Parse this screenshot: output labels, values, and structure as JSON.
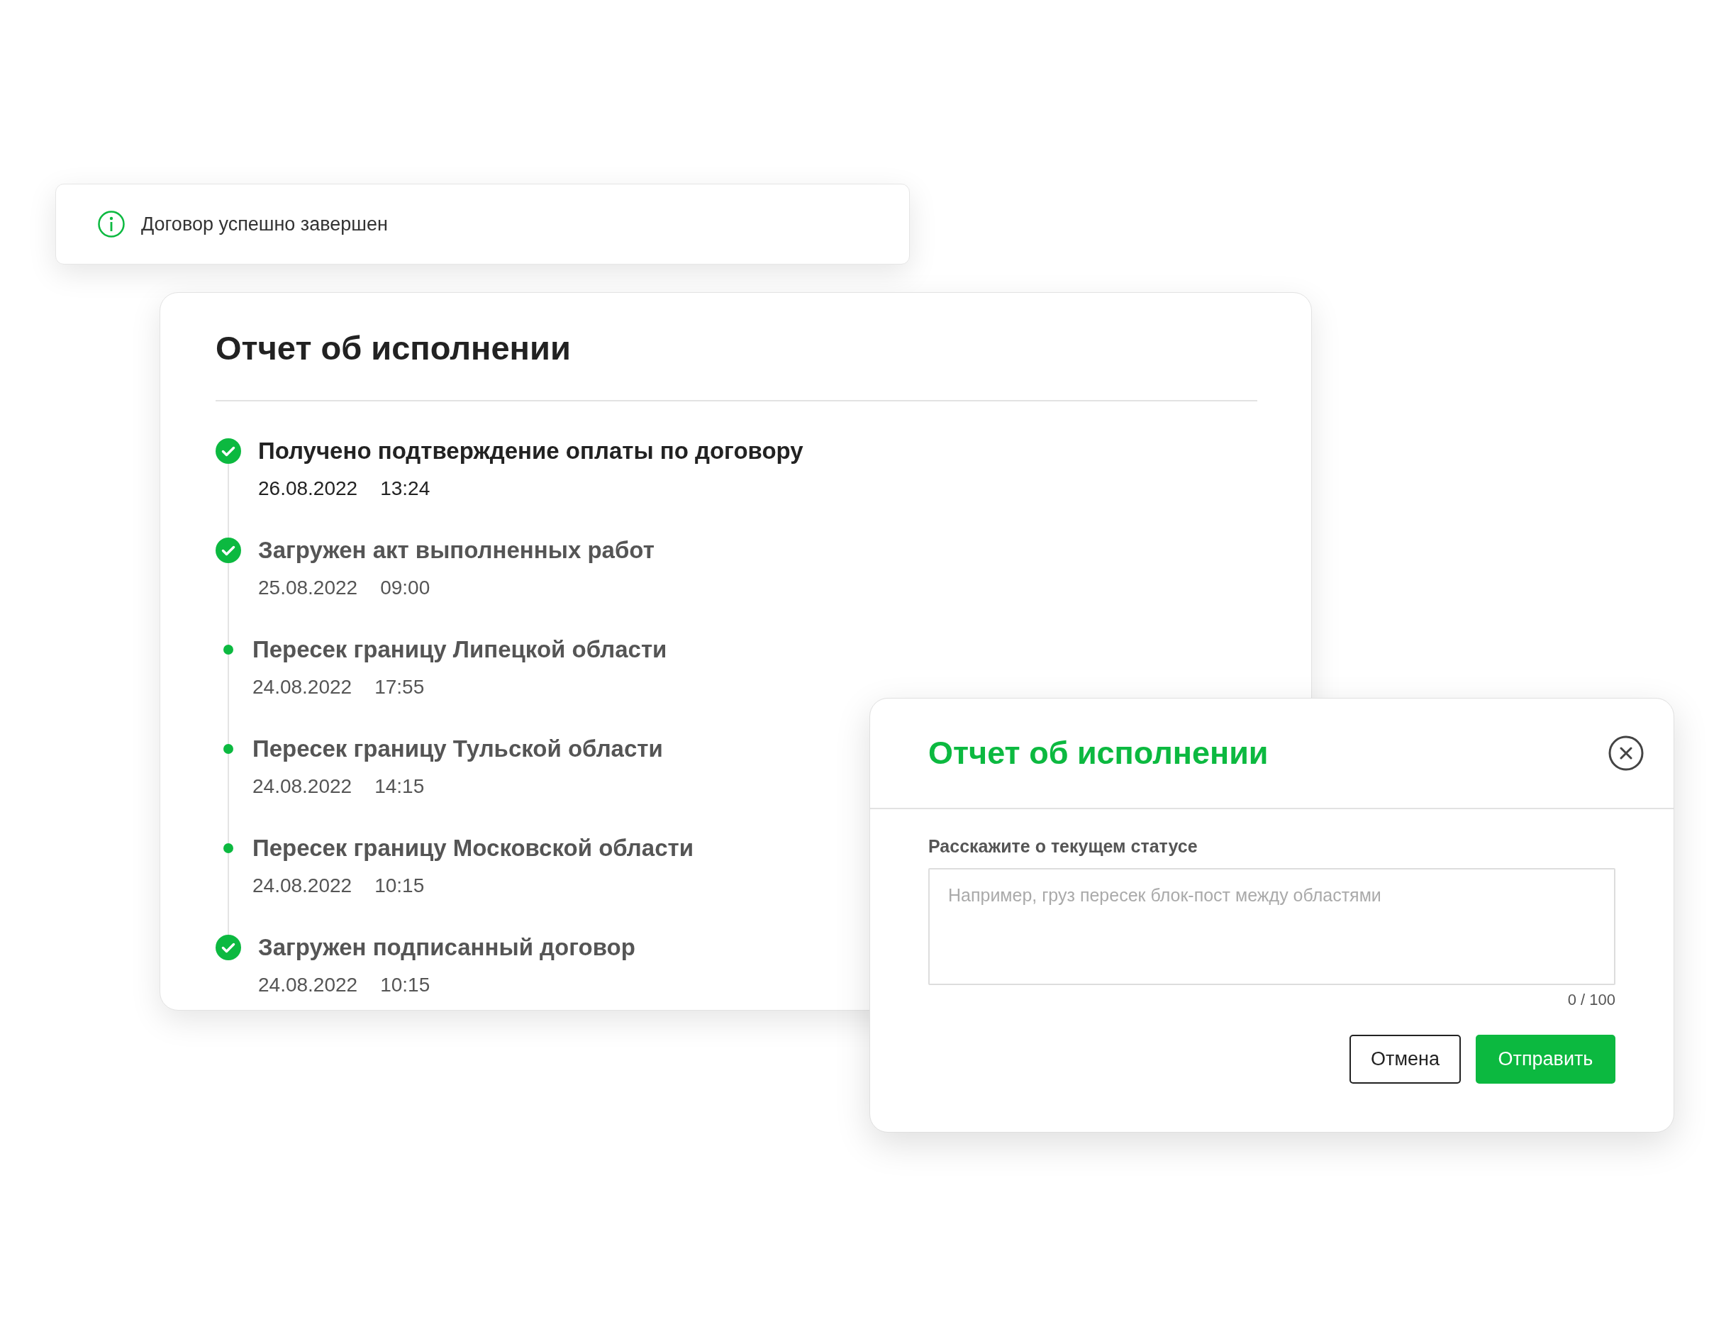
{
  "toast": {
    "message": "Договор успешно завершен"
  },
  "report": {
    "title": "Отчет об исполнении",
    "events": [
      {
        "kind": "done",
        "current": true,
        "title": "Получено подтверждение оплаты по договору",
        "date": "26.08.2022",
        "time": "13:24"
      },
      {
        "kind": "done",
        "current": false,
        "title": "Загружен акт выполненных работ",
        "date": "25.08.2022",
        "time": "09:00"
      },
      {
        "kind": "point",
        "current": false,
        "title": "Пересек границу Липецкой области",
        "date": "24.08.2022",
        "time": "17:55"
      },
      {
        "kind": "point",
        "current": false,
        "title": "Пересек границу Тульской области",
        "date": "24.08.2022",
        "time": "14:15"
      },
      {
        "kind": "point",
        "current": false,
        "title": "Пересек границу Московской области",
        "date": "24.08.2022",
        "time": "10:15"
      },
      {
        "kind": "done",
        "current": false,
        "title": "Загружен подписанный договор",
        "date": "24.08.2022",
        "time": "10:15"
      }
    ]
  },
  "dialog": {
    "title": "Отчет об исполнении",
    "field_label": "Расскажите о текущем статусе",
    "placeholder": "Например, груз пересек блок-пост между областями",
    "counter": "0 / 100",
    "buttons": [
      {
        "kind": "secondary",
        "label": "Отмена"
      },
      {
        "kind": "primary",
        "label": "Отправить"
      }
    ]
  }
}
